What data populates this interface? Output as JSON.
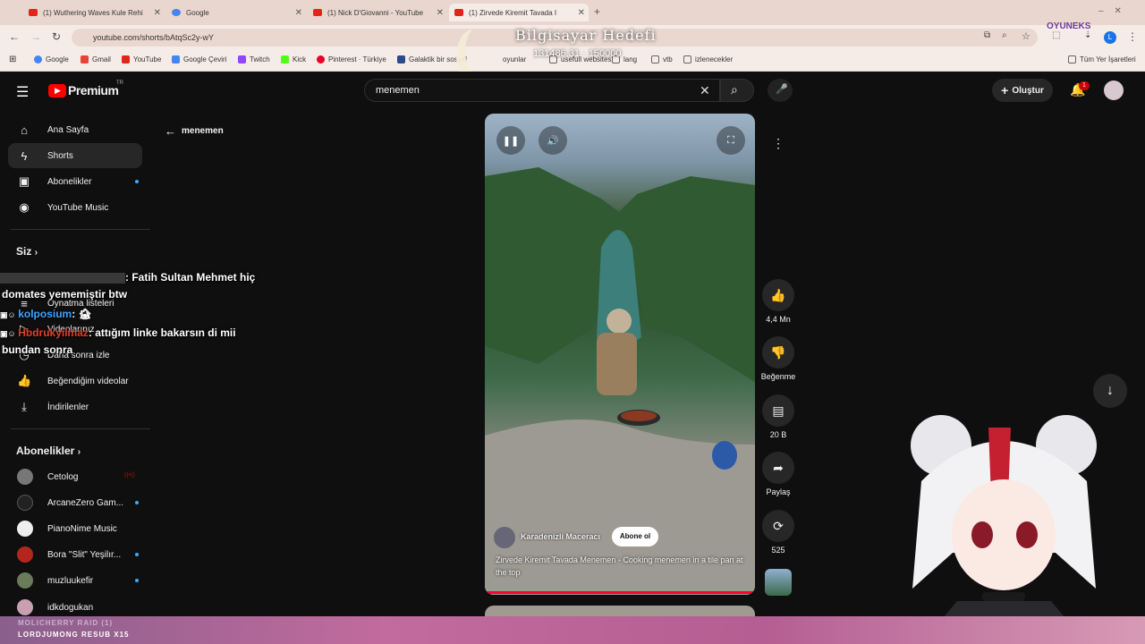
{
  "browser": {
    "tabs": [
      {
        "label": "(1) Wuthering Waves Kule Rehi",
        "color": "#e1251b"
      },
      {
        "label": "Google",
        "color": "#4285f4"
      },
      {
        "label": "(1) Nick D'Giovanni - YouTube",
        "color": "#e1251b"
      },
      {
        "label": "(1) Zirvede Kiremit Tavada I",
        "color": "#e1251b"
      }
    ],
    "url": "youtube.com/shorts/bAtqSc2y-wY",
    "bookmarks": [
      "Google",
      "Gmail",
      "YouTube",
      "Google Çeviri",
      "Twitch",
      "Kick",
      "Pinterest · Türkiye",
      "Galaktik bir sosyal",
      "oyunlar",
      "usefull websites",
      "lang",
      "vtb",
      "izlenecekler",
      "Tüm Yer İşaretleri"
    ]
  },
  "overlay": {
    "goal_title": "Bilgisayar Hedefi",
    "goal_value": "131486.31 · 150000",
    "brand": "OYUNEKS",
    "chat": [
      {
        "user": "",
        "message": ": Fatih Sultan Mehmet hiç"
      },
      {
        "user": "",
        "message": "domates yememiştir btw"
      },
      {
        "user": "kolposium",
        "message": ": 🏚"
      },
      {
        "user": "Hbdrukyılmaz",
        "message": ": attığım linke bakarsın di mii"
      },
      {
        "user": "",
        "message": "bundan sonra"
      }
    ],
    "alerts": [
      "MOLICHERRY RAID (1)",
      "LORDJUMONG RESUB X15"
    ]
  },
  "youtube": {
    "logo": "Premium",
    "country": "TR",
    "search_value": "menemen",
    "create_label": "Oluştur",
    "notif_count": "1",
    "back_label": "menemen",
    "sidebar": [
      {
        "label": "Ana Sayfa",
        "icon": "home-icon"
      },
      {
        "label": "Shorts",
        "icon": "shorts-icon"
      },
      {
        "label": "Abonelikler",
        "icon": "subscriptions-icon"
      },
      {
        "label": "YouTube Music",
        "icon": "music-icon"
      }
    ],
    "you_title": "Siz",
    "you_items": [
      {
        "label": "Oynatma listeleri"
      },
      {
        "label": "Videolarınız"
      },
      {
        "label": "Daha sonra izle"
      },
      {
        "label": "Beğendiğim videolar"
      },
      {
        "label": "İndirilenler"
      }
    ],
    "subs_title": "Abonelikler",
    "subs": [
      {
        "label": "Cetolog",
        "color": "#777"
      },
      {
        "label": "ArcaneZero Gam...",
        "color": "#222"
      },
      {
        "label": "PianoNime Music",
        "color": "#eee"
      },
      {
        "label": "Bora \"Slit\" Yeşilır...",
        "color": "#b3261e"
      },
      {
        "label": "muzluukefir",
        "color": "#6a7a5a"
      },
      {
        "label": "idkdogukan",
        "color": "#c8a0b0"
      }
    ],
    "short": {
      "channel": "Karadenizli Maceracı",
      "subscribe": "Abone ol",
      "title": "Zirvede Kiremit Tavada Menemen - Cooking menemen in a tile pan at the top",
      "likes": "4,4 Mn",
      "dislike": "Beğenme",
      "comments": "20 B",
      "share": "Paylaş",
      "remix": "525"
    }
  }
}
